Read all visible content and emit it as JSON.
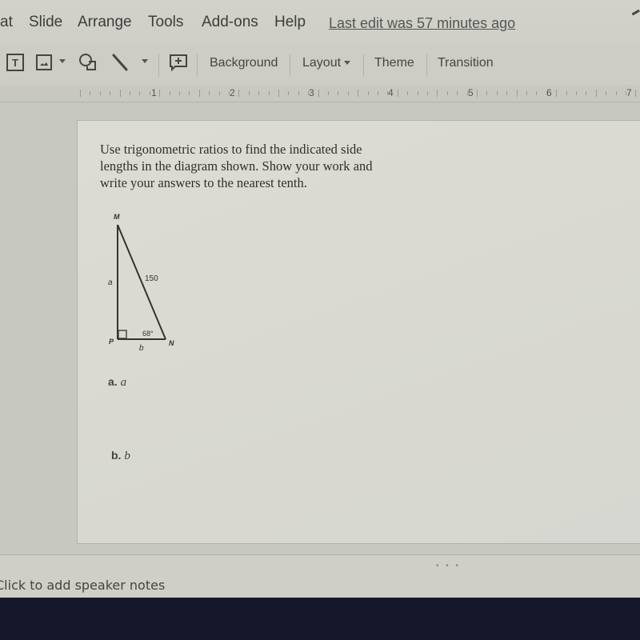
{
  "menubar": {
    "items": [
      "at",
      "Slide",
      "Arrange",
      "Tools",
      "Add-ons",
      "Help"
    ],
    "last_edit": "Last edit was 57 minutes ago"
  },
  "toolbar": {
    "icons": [
      "text-box-icon",
      "image-icon",
      "shape-icon",
      "line-icon",
      "comment-icon"
    ],
    "buttons": {
      "background": "Background",
      "layout": "Layout",
      "theme": "Theme",
      "transition": "Transition"
    }
  },
  "ruler": {
    "numbers": [
      "1",
      "2",
      "3",
      "4",
      "5",
      "6",
      "7"
    ]
  },
  "slide": {
    "problem_lines": [
      "Use trigonometric ratios to find the indicated side",
      "lengths in the diagram shown. Show your work and",
      "write your answers to the nearest tenth."
    ],
    "diagram": {
      "vertices": {
        "top": "M",
        "right_angle": "P",
        "right": "N"
      },
      "side_labels": {
        "vertical": "a",
        "hypotenuse": "150",
        "base": "b"
      },
      "angle_label": "68°"
    },
    "parts": [
      {
        "letter": "a.",
        "variable": "a"
      },
      {
        "letter": "b.",
        "variable": "b"
      }
    ]
  },
  "notes": {
    "placeholder": "Click to add speaker notes",
    "handle": "• • •"
  }
}
